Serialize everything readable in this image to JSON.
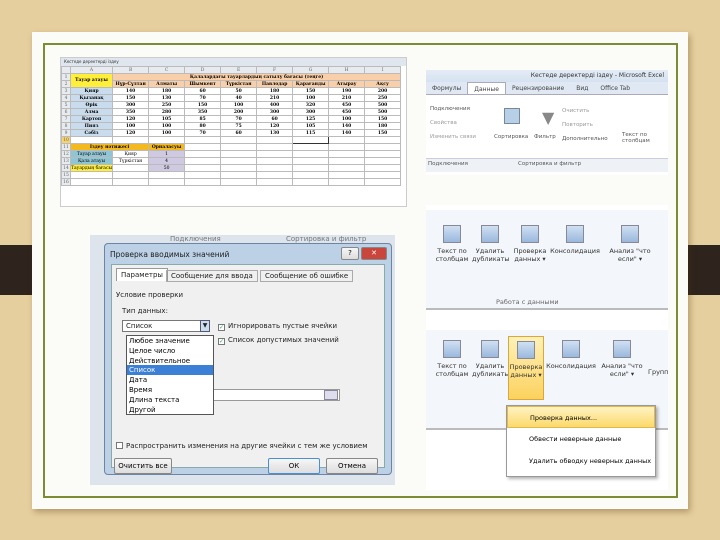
{
  "spreadsheet": {
    "tab": "Кестеде деректерді іздеу",
    "columns": [
      "A",
      "B",
      "C",
      "D",
      "E",
      "F",
      "G",
      "H",
      "I"
    ],
    "row_numbers": [
      "1",
      "2",
      "3",
      "4",
      "5",
      "6",
      "7",
      "8",
      "9",
      "10",
      "11",
      "12",
      "13",
      "14",
      "15",
      "16"
    ],
    "product_header": "Тауар атауы",
    "merged_header": "Қалалардағы тауарлардың сатылу бағасы (теңге)",
    "cities": [
      "Нұр-Сұлтан",
      "Алматы",
      "Шымкент",
      "Түркістан",
      "Павлодар",
      "Қарағанды",
      "Атырау",
      "Ақсу"
    ],
    "rows": [
      {
        "name": "Қияр",
        "values": [
          "140",
          "180",
          "60",
          "50",
          "180",
          "150",
          "190",
          "200"
        ]
      },
      {
        "name": "Қызанақ",
        "values": [
          "150",
          "130",
          "70",
          "40",
          "210",
          "100",
          "210",
          "250"
        ]
      },
      {
        "name": "Өрік",
        "values": [
          "300",
          "250",
          "150",
          "100",
          "400",
          "320",
          "450",
          "500"
        ]
      },
      {
        "name": "Алма",
        "values": [
          "350",
          "280",
          "350",
          "200",
          "300",
          "300",
          "450",
          "500"
        ]
      },
      {
        "name": "Картоп",
        "values": [
          "120",
          "105",
          "85",
          "70",
          "60",
          "125",
          "100",
          "150"
        ]
      },
      {
        "name": "Пияз",
        "values": [
          "100",
          "100",
          "80",
          "75",
          "120",
          "105",
          "140",
          "180"
        ]
      },
      {
        "name": "Сәбіз",
        "values": [
          "120",
          "100",
          "70",
          "60",
          "130",
          "115",
          "140",
          "150"
        ]
      }
    ],
    "lookup": {
      "header": "Іздеу нәтижесі",
      "position_header": "Орналасуы",
      "rows": [
        {
          "label": "Тауар атауы",
          "value": "Қияр",
          "pos": "1"
        },
        {
          "label": "Қала атауы",
          "value": "Түркістан",
          "pos": "4"
        },
        {
          "label": "Тауардың бағасы",
          "value": "",
          "pos": "50"
        }
      ]
    }
  },
  "ribbon1": {
    "window_title": "Кестеде деректерді іздеу - Microsoft Excel",
    "tabs": [
      "Формулы",
      "Данные",
      "Рецензирование",
      "Вид",
      "Office Tab"
    ],
    "active_tab": "Данные",
    "connections": [
      "Подключения",
      "Свойства",
      "Изменить связи"
    ],
    "sort": "Сортировка",
    "filter": "Фильтр",
    "filter_opts": [
      "Очистить",
      "Повторить",
      "Дополнительно"
    ],
    "text_cols": "Текст по столбцам",
    "groups": [
      "Подключения",
      "Сортировка и фильтр"
    ]
  },
  "dialog": {
    "bg_labels": [
      "Подключения",
      "Сортировка и фильтр"
    ],
    "title": "Проверка вводимых значений",
    "tabs": [
      "Параметры",
      "Сообщение для ввода",
      "Сообщение об ошибке"
    ],
    "section": "Условие проверки",
    "type_label": "Тип данных:",
    "type_value": "Список",
    "options": [
      "Любое значение",
      "Целое число",
      "Действительное",
      "Список",
      "Дата",
      "Время",
      "Длина текста",
      "Другой"
    ],
    "selected_option": "Список",
    "ignore_blank": "Игнорировать пустые ячейки",
    "in_cell_list": "Список допустимых значений",
    "apply_all": "Распространить изменения на другие ячейки с тем же условием",
    "clear_all": "Очистить все",
    "ok": "ОК",
    "cancel": "Отмена"
  },
  "ribbon2": {
    "buttons": [
      "Текст по столбцам",
      "Удалить дубликаты",
      "Проверка данных ▾",
      "Консолидация",
      "Анализ \"что если\" ▾"
    ],
    "group": "Работа с данными",
    "extra": "Группи...",
    "menu": [
      "Проверка данных...",
      "Обвести неверные данные",
      "Удалить обводку неверных данных"
    ]
  },
  "colors": {
    "background": "#e6cf9f",
    "frame": "#7d8b34",
    "bar": "#2e241d",
    "header_yellow": "#ffef3a",
    "highlight": "#fbd96a"
  }
}
